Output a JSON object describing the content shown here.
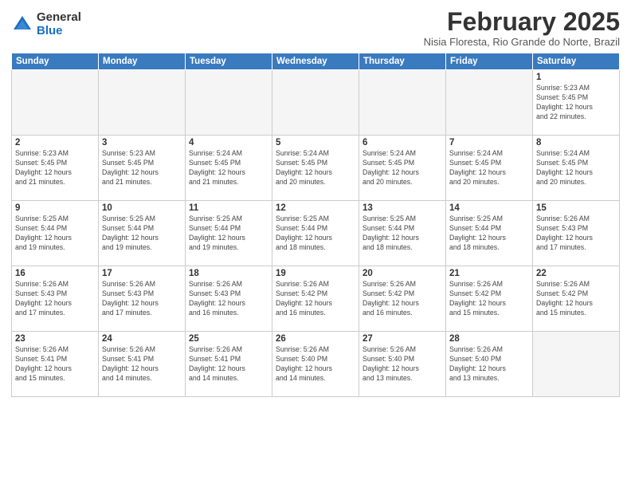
{
  "logo": {
    "general": "General",
    "blue": "Blue"
  },
  "header": {
    "month": "February 2025",
    "location": "Nisia Floresta, Rio Grande do Norte, Brazil"
  },
  "days_of_week": [
    "Sunday",
    "Monday",
    "Tuesday",
    "Wednesday",
    "Thursday",
    "Friday",
    "Saturday"
  ],
  "weeks": [
    [
      {
        "day": "",
        "info": ""
      },
      {
        "day": "",
        "info": ""
      },
      {
        "day": "",
        "info": ""
      },
      {
        "day": "",
        "info": ""
      },
      {
        "day": "",
        "info": ""
      },
      {
        "day": "",
        "info": ""
      },
      {
        "day": "1",
        "info": "Sunrise: 5:23 AM\nSunset: 5:45 PM\nDaylight: 12 hours\nand 22 minutes."
      }
    ],
    [
      {
        "day": "2",
        "info": "Sunrise: 5:23 AM\nSunset: 5:45 PM\nDaylight: 12 hours\nand 21 minutes."
      },
      {
        "day": "3",
        "info": "Sunrise: 5:23 AM\nSunset: 5:45 PM\nDaylight: 12 hours\nand 21 minutes."
      },
      {
        "day": "4",
        "info": "Sunrise: 5:24 AM\nSunset: 5:45 PM\nDaylight: 12 hours\nand 21 minutes."
      },
      {
        "day": "5",
        "info": "Sunrise: 5:24 AM\nSunset: 5:45 PM\nDaylight: 12 hours\nand 20 minutes."
      },
      {
        "day": "6",
        "info": "Sunrise: 5:24 AM\nSunset: 5:45 PM\nDaylight: 12 hours\nand 20 minutes."
      },
      {
        "day": "7",
        "info": "Sunrise: 5:24 AM\nSunset: 5:45 PM\nDaylight: 12 hours\nand 20 minutes."
      },
      {
        "day": "8",
        "info": "Sunrise: 5:24 AM\nSunset: 5:45 PM\nDaylight: 12 hours\nand 20 minutes."
      }
    ],
    [
      {
        "day": "9",
        "info": "Sunrise: 5:25 AM\nSunset: 5:44 PM\nDaylight: 12 hours\nand 19 minutes."
      },
      {
        "day": "10",
        "info": "Sunrise: 5:25 AM\nSunset: 5:44 PM\nDaylight: 12 hours\nand 19 minutes."
      },
      {
        "day": "11",
        "info": "Sunrise: 5:25 AM\nSunset: 5:44 PM\nDaylight: 12 hours\nand 19 minutes."
      },
      {
        "day": "12",
        "info": "Sunrise: 5:25 AM\nSunset: 5:44 PM\nDaylight: 12 hours\nand 18 minutes."
      },
      {
        "day": "13",
        "info": "Sunrise: 5:25 AM\nSunset: 5:44 PM\nDaylight: 12 hours\nand 18 minutes."
      },
      {
        "day": "14",
        "info": "Sunrise: 5:25 AM\nSunset: 5:44 PM\nDaylight: 12 hours\nand 18 minutes."
      },
      {
        "day": "15",
        "info": "Sunrise: 5:26 AM\nSunset: 5:43 PM\nDaylight: 12 hours\nand 17 minutes."
      }
    ],
    [
      {
        "day": "16",
        "info": "Sunrise: 5:26 AM\nSunset: 5:43 PM\nDaylight: 12 hours\nand 17 minutes."
      },
      {
        "day": "17",
        "info": "Sunrise: 5:26 AM\nSunset: 5:43 PM\nDaylight: 12 hours\nand 17 minutes."
      },
      {
        "day": "18",
        "info": "Sunrise: 5:26 AM\nSunset: 5:43 PM\nDaylight: 12 hours\nand 16 minutes."
      },
      {
        "day": "19",
        "info": "Sunrise: 5:26 AM\nSunset: 5:42 PM\nDaylight: 12 hours\nand 16 minutes."
      },
      {
        "day": "20",
        "info": "Sunrise: 5:26 AM\nSunset: 5:42 PM\nDaylight: 12 hours\nand 16 minutes."
      },
      {
        "day": "21",
        "info": "Sunrise: 5:26 AM\nSunset: 5:42 PM\nDaylight: 12 hours\nand 15 minutes."
      },
      {
        "day": "22",
        "info": "Sunrise: 5:26 AM\nSunset: 5:42 PM\nDaylight: 12 hours\nand 15 minutes."
      }
    ],
    [
      {
        "day": "23",
        "info": "Sunrise: 5:26 AM\nSunset: 5:41 PM\nDaylight: 12 hours\nand 15 minutes."
      },
      {
        "day": "24",
        "info": "Sunrise: 5:26 AM\nSunset: 5:41 PM\nDaylight: 12 hours\nand 14 minutes."
      },
      {
        "day": "25",
        "info": "Sunrise: 5:26 AM\nSunset: 5:41 PM\nDaylight: 12 hours\nand 14 minutes."
      },
      {
        "day": "26",
        "info": "Sunrise: 5:26 AM\nSunset: 5:40 PM\nDaylight: 12 hours\nand 14 minutes."
      },
      {
        "day": "27",
        "info": "Sunrise: 5:26 AM\nSunset: 5:40 PM\nDaylight: 12 hours\nand 13 minutes."
      },
      {
        "day": "28",
        "info": "Sunrise: 5:26 AM\nSunset: 5:40 PM\nDaylight: 12 hours\nand 13 minutes."
      },
      {
        "day": "",
        "info": ""
      }
    ]
  ]
}
